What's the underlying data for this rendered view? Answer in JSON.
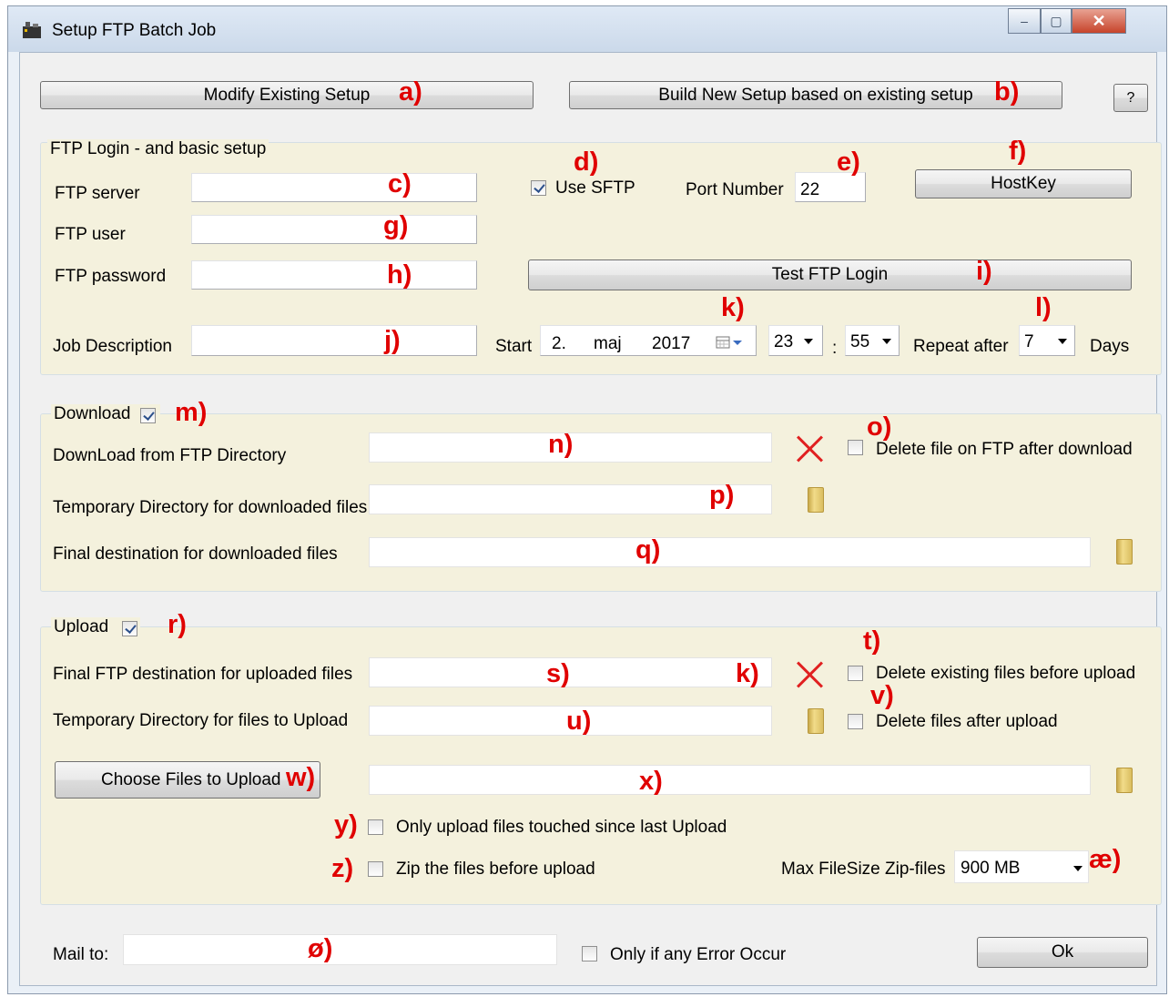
{
  "window": {
    "title": "Setup FTP Batch Job",
    "minimize": "–",
    "maximize": "▢",
    "close": "✕"
  },
  "top": {
    "modify_label": "Modify Existing Setup",
    "build_label": "Build New Setup based on existing setup",
    "help_label": "?"
  },
  "login": {
    "group_title": "FTP Login - and basic setup",
    "server_label": "FTP server",
    "server_value": "",
    "user_label": "FTP user",
    "user_value": "",
    "password_label": "FTP password",
    "password_value": "",
    "use_sftp_label": "Use SFTP",
    "use_sftp_checked": true,
    "port_label": "Port Number",
    "port_value": "22",
    "hostkey_label": "HostKey",
    "test_label": "Test FTP Login",
    "job_desc_label": "Job Description",
    "job_desc_value": "",
    "start_label": "Start",
    "start_day": "2.",
    "start_month": "maj",
    "start_year": "2017",
    "hour": "23",
    "time_sep": ":",
    "minute": "55",
    "repeat_label": "Repeat after",
    "repeat_value": "7",
    "days_label": "Days"
  },
  "download": {
    "group_title": "Download",
    "enabled": true,
    "from_dir_label": "DownLoad from FTP Directory",
    "from_dir_value": "",
    "delete_label": "Delete file on FTP after download",
    "delete_checked": false,
    "temp_dir_label": "Temporary Directory for downloaded files",
    "temp_dir_value": "",
    "final_dir_label": "Final destination for downloaded files",
    "final_dir_value": ""
  },
  "upload": {
    "group_title": "Upload",
    "enabled": true,
    "dest_label": "Final FTP destination for uploaded files",
    "dest_value": "",
    "delete_existing_label": "Delete existing files before upload",
    "delete_existing_checked": false,
    "temp_dir_label": "Temporary Directory for files to Upload",
    "temp_dir_value": "",
    "delete_after_label": "Delete files after upload",
    "delete_after_checked": false,
    "choose_label": "Choose Files to Upload",
    "files_value": "",
    "only_touched_label": "Only upload files touched since last Upload",
    "only_touched_checked": false,
    "zip_label": "Zip the files before upload",
    "zip_checked": false,
    "max_size_label": "Max FileSize Zip-files",
    "max_size_value": "900 MB"
  },
  "mail": {
    "label": "Mail to:",
    "value": "",
    "only_error_label": "Only if any Error Occur",
    "only_error_checked": false,
    "ok_label": "Ok"
  },
  "annotations": {
    "a": "a)",
    "b": "b)",
    "c": "c)",
    "d": "d)",
    "e": "e)",
    "f": "f)",
    "g": "g)",
    "h": "h)",
    "i": "i)",
    "j": "j)",
    "k": "k)",
    "l": "l)",
    "m": "m)",
    "n": "n)",
    "o": "o)",
    "p": "p)",
    "q": "q)",
    "r": "r)",
    "s": "s)",
    "k2": "k)",
    "t": "t)",
    "u": "u)",
    "v": "v)",
    "w": "w)",
    "x": "x)",
    "y": "y)",
    "z": "z)",
    "ae": "æ)",
    "oe": "ø)"
  }
}
